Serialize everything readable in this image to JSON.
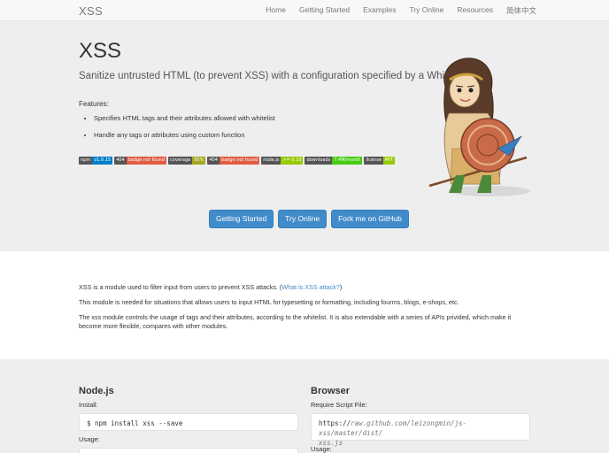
{
  "nav": {
    "brand": "XSS",
    "links": [
      "Home",
      "Getting Started",
      "Examples",
      "Try Online",
      "Resources",
      "简体中文"
    ]
  },
  "hero": {
    "title": "XSS",
    "subtitle": "Sanitize untrusted HTML (to prevent XSS) with a configuration specified by a Whitelist.",
    "features_label": "Features:",
    "features": [
      "Specifies HTML tags and their attributes allowed with whitelist",
      "Handle any tags or attributes using custom function"
    ],
    "badges": [
      {
        "left": "npm",
        "right": "v1.0.15",
        "color": "#007ec6"
      },
      {
        "left": "404",
        "right": "badge not found",
        "color": "#e05d44"
      },
      {
        "left": "coverage",
        "right": "95%",
        "color": "#a4a61d"
      },
      {
        "left": "404",
        "right": "badge not found",
        "color": "#e05d44"
      },
      {
        "left": "node.js",
        "right": ">= 0.10",
        "color": "#97ca00"
      },
      {
        "left": "downloads",
        "right": "7.4M/month",
        "color": "#4c1"
      },
      {
        "left": "license",
        "right": "MIT",
        "color": "#97ca00"
      }
    ],
    "buttons": [
      "Getting Started",
      "Try Online",
      "Fork me on GitHub"
    ]
  },
  "desc": {
    "p1_text": "XSS is a module used to filter input from users to prevent XSS attacks. (",
    "p1_link": "What is XSS attack?",
    "p1_end": ")",
    "p2": "This module is needed for situations that allows users to input HTML for typesetting or formatting, including fourms, blogs, e-shops, etc.",
    "p3": "The xss module controls the usage of tags and their attributes, according to the whitelist. It is also extendable with a series of APIs privided, which make it become more flexible, compares with other modules."
  },
  "node": {
    "title": "Node.js",
    "install_label": "Install:",
    "install_cmd": "$ npm install xss --save",
    "usage_label": "Usage:"
  },
  "browser": {
    "title": "Browser",
    "script_label": "Require Script File:",
    "url_prefix": "https://",
    "url_rest_1": "raw.github.com/leizongmin/js-xss/master/dist/",
    "url_rest_2": "xss.js",
    "usage_label": "Usage:"
  }
}
